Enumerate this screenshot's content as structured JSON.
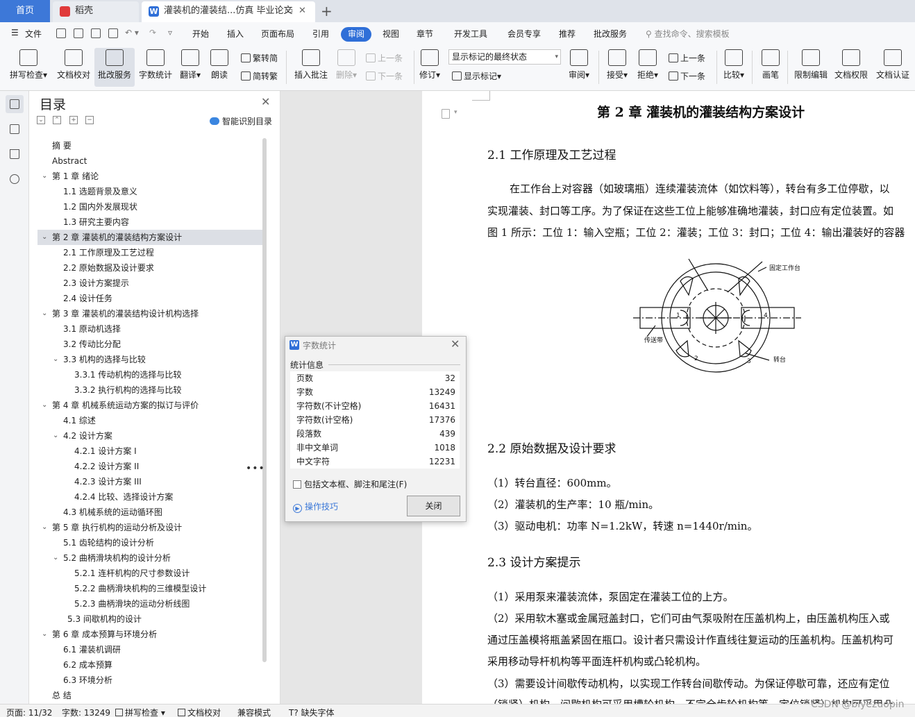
{
  "tabs": {
    "home": "首页",
    "daoke": "稻壳",
    "document": "灌装机的灌装结...仿真 毕业论文"
  },
  "menu": {
    "file": "文件",
    "items": [
      "开始",
      "插入",
      "页面布局",
      "引用",
      "审阅",
      "视图",
      "章节",
      "开发工具",
      "会员专享",
      "推荐",
      "批改服务"
    ],
    "active": "审阅",
    "search": "查找命令、搜索模板"
  },
  "ribbon": {
    "spellcheck": "拼写检查",
    "doc_check": "文档校对",
    "grading": "批改服务",
    "word_count": "字数统计",
    "translate": "翻译",
    "read_aloud": "朗读",
    "to_traditional": "繁转简",
    "to_simplified": "简转繁",
    "insert_comment": "插入批注",
    "delete": "删除",
    "prev": "上一条",
    "next": "下一条",
    "track": "修订",
    "markup_state": "显示标记的最终状态",
    "show_markup": "显示标记",
    "review": "审阅",
    "accept": "接受",
    "reject": "拒绝",
    "prev2": "上一条",
    "next2": "下一条",
    "compare": "比较",
    "pen": "画笔",
    "restrict": "限制编辑",
    "doc_rights": "文档权限",
    "doc_cert": "文档认证"
  },
  "toc": {
    "title": "目录",
    "smart": "智能识别目录",
    "items": [
      {
        "text": "摘    要",
        "level": 1,
        "toggle": false
      },
      {
        "text": "Abstract",
        "level": 1,
        "toggle": false
      },
      {
        "text": "第 1 章  绪论",
        "level": 1,
        "toggle": true
      },
      {
        "text": "1.1 选题背景及意义",
        "level": 2,
        "toggle": false
      },
      {
        "text": "1.2 国内外发展现状",
        "level": 2,
        "toggle": false
      },
      {
        "text": "1.3 研究主要内容",
        "level": 2,
        "toggle": false
      },
      {
        "text": "第 2 章  灌装机的灌装结构方案设计",
        "level": 1,
        "toggle": true,
        "selected": true
      },
      {
        "text": "2.1 工作原理及工艺过程",
        "level": 2,
        "toggle": false
      },
      {
        "text": "2.2 原始数据及设计要求",
        "level": 2,
        "toggle": false
      },
      {
        "text": "2.3 设计方案提示",
        "level": 2,
        "toggle": false
      },
      {
        "text": "2.4 设计任务",
        "level": 2,
        "toggle": false
      },
      {
        "text": "第 3 章  灌装机的灌装结构设计机构选择",
        "level": 1,
        "toggle": true
      },
      {
        "text": "3.1 原动机选择",
        "level": 2,
        "toggle": false
      },
      {
        "text": "3.2 传动比分配",
        "level": 2,
        "toggle": false
      },
      {
        "text": "3.3 机构的选择与比较",
        "level": 2,
        "toggle": true
      },
      {
        "text": "3.3.1 传动机构的选择与比较",
        "level": 3,
        "toggle": false
      },
      {
        "text": "3.3.2 执行机构的选择与比较",
        "level": 3,
        "toggle": false
      },
      {
        "text": "第 4 章  机械系统运动方案的拟订与评价",
        "level": 1,
        "toggle": true
      },
      {
        "text": "4.1 综述",
        "level": 2,
        "toggle": false
      },
      {
        "text": "4.2 设计方案",
        "level": 2,
        "toggle": true
      },
      {
        "text": "4.2.1  设计方案 I",
        "level": 3,
        "toggle": false
      },
      {
        "text": "4.2.2  设计方案 II",
        "level": 3,
        "toggle": false
      },
      {
        "text": "4.2.3  设计方案 III",
        "level": 3,
        "toggle": false
      },
      {
        "text": "4.2.4 比较、选择设计方案",
        "level": 3,
        "toggle": false
      },
      {
        "text": "4.3 机械系统的运动循环图",
        "level": 2,
        "toggle": false
      },
      {
        "text": "第 5 章  执行机构的运动分析及设计",
        "level": 1,
        "toggle": true
      },
      {
        "text": "5.1 齿轮结构的设计分析",
        "level": 2,
        "toggle": false
      },
      {
        "text": "5.2 曲柄滑块机构的设计分析",
        "level": 2,
        "toggle": true
      },
      {
        "text": "5.2.1 连杆机构的尺寸参数设计",
        "level": 3,
        "toggle": false
      },
      {
        "text": "5.2.2 曲柄滑块机构的三维模型设计",
        "level": 3,
        "toggle": false
      },
      {
        "text": "5.2.3  曲柄滑块的运动分析线图",
        "level": 3,
        "toggle": false
      },
      {
        "text": "5.3  间歇机构的设计",
        "level": 2,
        "toggle": false,
        "indent": 22
      },
      {
        "text": "第 6 章  成本预算与环境分析",
        "level": 1,
        "toggle": true
      },
      {
        "text": "6.1   灌装机调研",
        "level": 2,
        "toggle": false
      },
      {
        "text": "6.2   成本预算",
        "level": 2,
        "toggle": false
      },
      {
        "text": "6.3  环境分析",
        "level": 2,
        "toggle": false
      },
      {
        "text": "总    结",
        "level": 1,
        "toggle": false
      }
    ]
  },
  "document": {
    "chapter_title": "第 2 章  灌装机的灌装结构方案设计",
    "s21": "2.1 工作原理及工艺过程",
    "p21_1": "在工作台上对容器（如玻璃瓶）连续灌装流体（如饮料等），转台有多工位停歇，以",
    "p21_2": "实现灌装、封口等工序。为了保证在这些工位上能够准确地灌装，封口应有定位装置。如",
    "p21_3": "图 1 所示：工位 1：输入空瓶；工位 2：灌装；工位 3：封口；工位 4：输出灌装好的容器",
    "fig_fixed": "固定工作台",
    "fig_belt": "传送带",
    "fig_turntable": "转台",
    "fig_n1": "1",
    "fig_n2": "2",
    "fig_n3": "3",
    "fig_n4": "4",
    "s22": "2.2 原始数据及设计要求",
    "p22_1": "（1）转台直径：600mm。",
    "p22_2": "（2）灌装机的生产率：10 瓶/min。",
    "p22_3": "（3）驱动电机：功率 N=1.2kW，转速 n=1440r/min。",
    "s23": "2.3 设计方案提示",
    "p23_1": "（1）采用泵来灌装流体，泵固定在灌装工位的上方。",
    "p23_2": "（2）采用软木塞或金属冠盖封口，它们可由气泵吸附在压盖机构上，由压盖机构压入或",
    "p23_3": "通过压盖模将瓶盖紧固在瓶口。设计者只需设计作直线往复运动的压盖机构。压盖机构可",
    "p23_4": "采用移动导杆机构等平面连杆机构或凸轮机构。",
    "p23_5": "（3）需要设计间歇传动机构，以实现工作转台间歇传动。为保证停歇可靠，还应有定位",
    "p23_6": "（锁紧）机构。间歇机构可采用槽轮机构、不完全齿轮机构等。定位锁紧）机构可采用凸"
  },
  "dialog": {
    "title": "字数统计",
    "group": "统计信息",
    "rows": [
      {
        "label": "页数",
        "value": "32"
      },
      {
        "label": "字数",
        "value": "13249"
      },
      {
        "label": "字符数(不计空格)",
        "value": "16431"
      },
      {
        "label": "字符数(计空格)",
        "value": "17376"
      },
      {
        "label": "段落数",
        "value": "439"
      },
      {
        "label": "非中文单词",
        "value": "1018"
      },
      {
        "label": "中文字符",
        "value": "12231"
      }
    ],
    "checkbox": "包括文本框、脚注和尾注(F)",
    "tips": "操作技巧",
    "close": "关闭"
  },
  "status": {
    "page": "页面: 11/32",
    "words": "字数: 13249",
    "spell": "拼写检查",
    "proof": "文档校对",
    "compat": "兼容模式",
    "missing_font": "缺失字体"
  },
  "watermark": "CSDN @biyezuopin"
}
